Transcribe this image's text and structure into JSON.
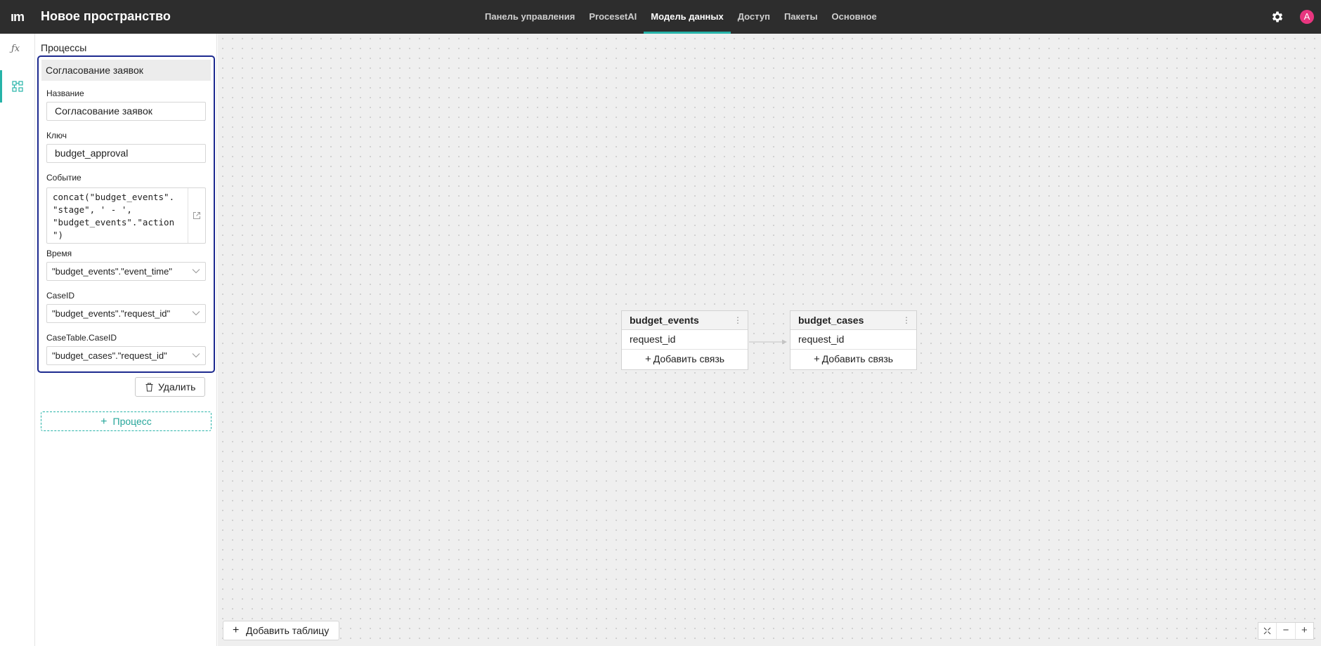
{
  "header": {
    "logo": "ım",
    "title": "Новое пространство",
    "nav": [
      {
        "label": "Панель управления"
      },
      {
        "label": "ProcesetAI"
      },
      {
        "label": "Модель данных"
      },
      {
        "label": "Доступ"
      },
      {
        "label": "Пакеты"
      },
      {
        "label": "Основное"
      }
    ],
    "active_nav": "Модель данных",
    "avatar_letter": "A"
  },
  "rail": {
    "fx_label": "ƒx"
  },
  "panel": {
    "title": "Процессы",
    "process": {
      "header": "Согласование заявок",
      "name_label": "Название",
      "name_value": "Согласование заявок",
      "key_label": "Ключ",
      "key_value": "budget_approval",
      "event_label": "Событие",
      "event_value": "concat(\"budget_events\".\n\"stage\", ' - ',\n\"budget_events\".\"action\n\")",
      "time_label": "Время",
      "time_value": "\"budget_events\".\"event_time\"",
      "caseid_label": "CaseID",
      "caseid_value": "\"budget_events\".\"request_id\"",
      "casetable_label": "CaseTable.CaseID",
      "casetable_value": "\"budget_cases\".\"request_id\""
    },
    "delete_label": "Удалить",
    "add_process_label": "Процесс"
  },
  "canvas": {
    "tables": [
      {
        "name": "budget_events",
        "field": "request_id",
        "add_link_label": "Добавить связь"
      },
      {
        "name": "budget_cases",
        "field": "request_id",
        "add_link_label": "Добавить связь"
      }
    ],
    "add_table_label": "Добавить таблицу",
    "zoom_controls": [
      "fit-icon",
      "zoom-out-icon",
      "zoom-in-icon"
    ]
  },
  "colors": {
    "accent": "#26b3a8",
    "selection_border": "#1d2a8f",
    "avatar": "#e8367f",
    "topbar": "#2d2d2d"
  }
}
